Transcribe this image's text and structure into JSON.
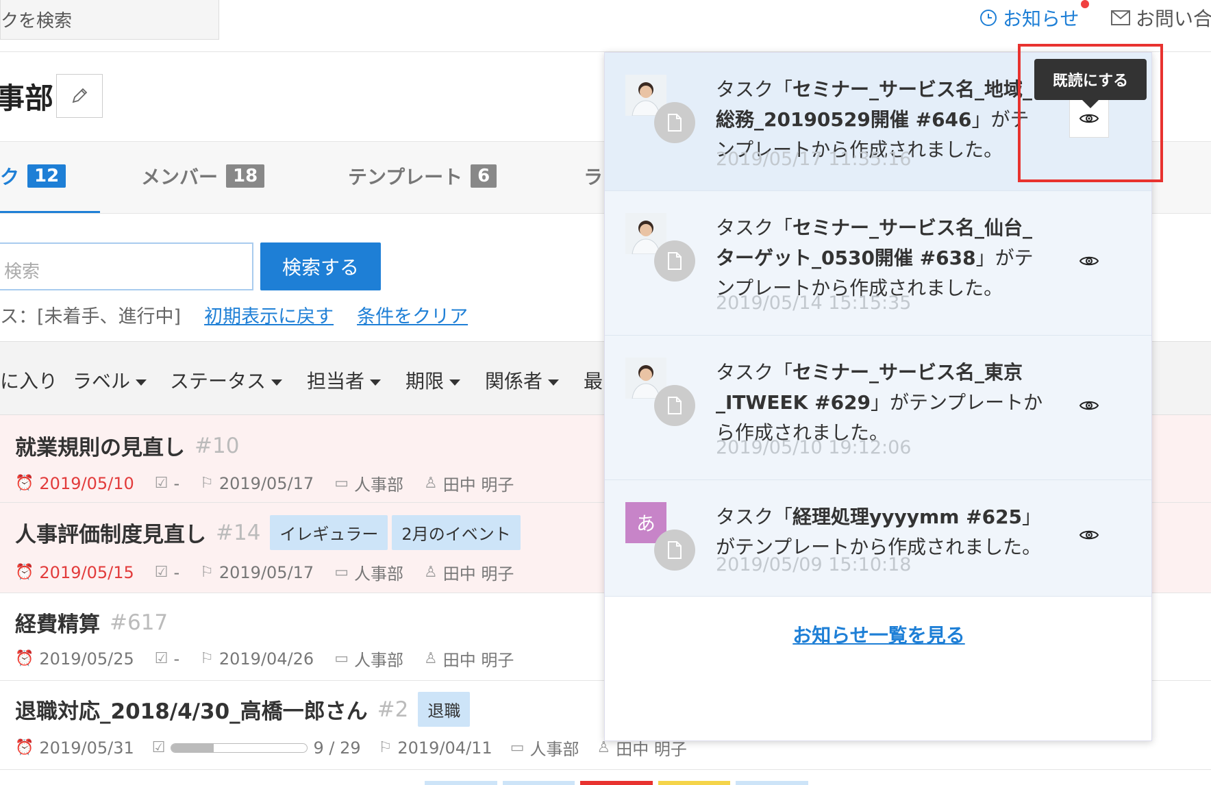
{
  "topbar": {
    "search_text": "クを検索",
    "notifications_label": "お知らせ",
    "contact_label": "お問い合"
  },
  "project": {
    "title": "事部"
  },
  "tabs": [
    {
      "label": "ク",
      "count": "12"
    },
    {
      "label": "メンバー",
      "count": "18"
    },
    {
      "label": "テンプレート",
      "count": "6"
    },
    {
      "label": "ラ"
    }
  ],
  "search": {
    "placeholder": "検索",
    "button_label": "検索する",
    "condition_text": "ス：[未着手、進行中]",
    "reset_link": "初期表示に戻す",
    "clear_link": "条件をクリア"
  },
  "filters": [
    "に入り",
    "ラベル",
    "ステータス",
    "担当者",
    "期限",
    "関係者",
    "最"
  ],
  "tasks": [
    {
      "title": "就業規則の見直し",
      "num": "#10",
      "labels": [],
      "due": "2019/05/10",
      "check": "-",
      "start": "2019/05/17",
      "folder": "人事部",
      "assignee": "田中 明子"
    },
    {
      "title": "人事評価制度見直し",
      "num": "#14",
      "labels": [
        "イレギュラー",
        "2月のイベント"
      ],
      "due": "2019/05/15",
      "check": "-",
      "start": "2019/05/17",
      "folder": "人事部",
      "assignee": "田中 明子"
    },
    {
      "title": "経費精算",
      "num": "#617",
      "labels": [],
      "due": "2019/05/25",
      "check": "-",
      "start": "2019/04/26",
      "folder": "人事部",
      "assignee": "田中 明子"
    },
    {
      "title": "退職対応_2018/4/30_高橋一郎さん",
      "num": "#2",
      "labels": [
        "退職"
      ],
      "due": "2019/05/31",
      "progress_text": "9 / 29",
      "progress": 0.31,
      "start": "2019/04/11",
      "folder": "人事部",
      "assignee": "田中 明子"
    }
  ],
  "notifications": [
    {
      "pre": "タスク「",
      "bold": "セミナー_サービス名_地域_総務_20190529開催 #646",
      "post": "」がテンプレートから作成されました。",
      "time": "2019/05/17 11:35:16",
      "avatar": "photo"
    },
    {
      "pre": "タスク「",
      "bold": "セミナー_サービス名_仙台_ターゲット_0530開催 #638",
      "post": "」がテンプレートから作成されました。",
      "time": "2019/05/14 15:15:35",
      "avatar": "photo"
    },
    {
      "pre": "タスク「",
      "bold": "セミナー_サービス名_東京_ITWEEK #629",
      "post": "」がテンプレートから作成されました。",
      "time": "2019/05/10 19:12:06",
      "avatar": "photo"
    },
    {
      "pre": "タスク「",
      "bold": "経理処理yyyymm #625",
      "post": "」がテンプレートから作成されました。",
      "time": "2019/05/09 15:10:18",
      "avatar": "あ"
    }
  ],
  "panel": {
    "see_all_label": "お知らせ一覧を見る",
    "tooltip": "既読にする"
  },
  "colors": {
    "accent": "#1e7fd6",
    "overdue": "#e23b3b",
    "highlight": "#e8322f"
  }
}
